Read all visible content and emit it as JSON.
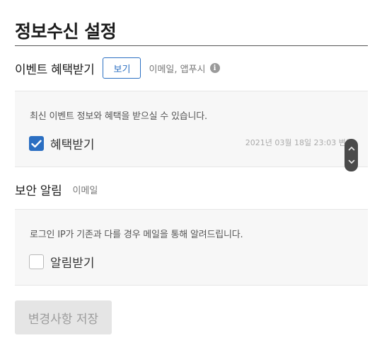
{
  "page": {
    "title": "정보수신 설정"
  },
  "event_section": {
    "title": "이벤트 혜택받기",
    "view_button_label": "보기",
    "channels": "이메일, 앱푸시",
    "info_icon_glyph": "i",
    "description": "최신 이벤트 정보와 혜택을 받으실 수 있습니다.",
    "checkbox_label": "혜택받기",
    "checkbox_checked": true,
    "changed_at": "2021년 03월 18일 23:03 변경"
  },
  "security_section": {
    "title": "보안 알림",
    "channels": "이메일",
    "description": "로그인 IP가 기존과 다를 경우 메일을 통해 알려드립니다.",
    "checkbox_label": "알림받기",
    "checkbox_checked": false
  },
  "footer": {
    "save_label": "변경사항 저장"
  },
  "icons": {
    "checkbox_checked": "checkmark-icon",
    "info": "info-icon",
    "scroll_up": "chevron-up-icon",
    "scroll_down": "chevron-down-icon"
  },
  "colors": {
    "accent": "#2b6fc2",
    "panel_background": "#f7f7f7",
    "disabled_button": "#e5e5e5"
  }
}
